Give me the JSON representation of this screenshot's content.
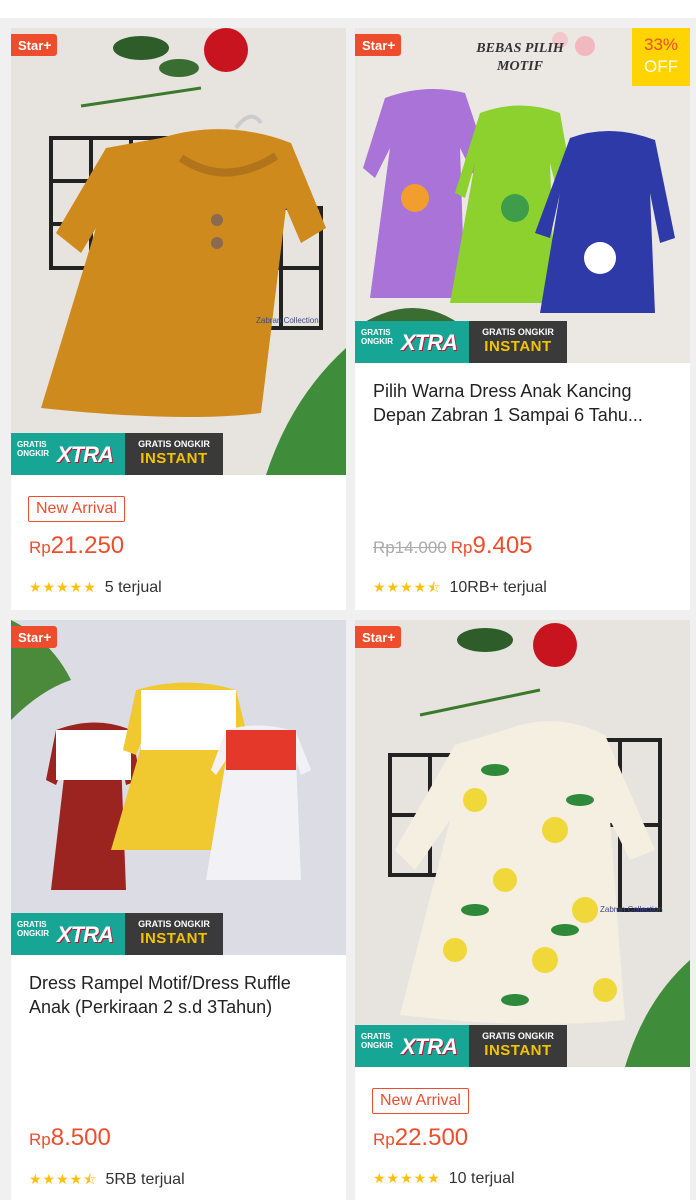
{
  "badges": {
    "star_plus": "Star",
    "plus_sign": "+"
  },
  "shipping": {
    "gratis_ongkir": "GRATIS ONGKIR",
    "xtra": "XTRA",
    "gratis_ongkir_instant_top": "GRATIS ONGKIR",
    "instant": "INSTANT"
  },
  "products": [
    {
      "title": "",
      "tag": "New Arrival",
      "price_currency": "Rp",
      "price_value": "21.250",
      "old_price": "",
      "rating_stars": "★★★★★",
      "sold": "5 terjual",
      "watermark": "Zabran Collection"
    },
    {
      "title": "Pilih Warna Dress Anak Kancing Depan Zabran 1 Sampai 6 Tahu...",
      "tag": "",
      "price_currency": "Rp",
      "price_value": "9.405",
      "old_price": "Rp14.000",
      "discount_pct": "33%",
      "discount_off": "OFF",
      "image_caption": "BEBAS PILIH MOTIF",
      "rating_stars": "★★★★⯪",
      "sold": "10RB+ terjual"
    },
    {
      "title": "Dress Rampel Motif/Dress Ruffle Anak (Perkiraan 2 s.d 3Tahun)",
      "tag": "",
      "price_currency": "Rp",
      "price_value": "8.500",
      "old_price": "",
      "rating_stars": "★★★★⯪",
      "sold": "5RB terjual"
    },
    {
      "title": "",
      "tag": "New Arrival",
      "price_currency": "Rp",
      "price_value": "22.500",
      "old_price": "",
      "rating_stars": "★★★★★",
      "sold": "10 terjual",
      "watermark": "Zabran Collection"
    }
  ],
  "colors": {
    "accent": "#ee4d2d",
    "star": "#ffc107",
    "xtra_teal": "#17a595",
    "instant_dark": "#3a3a3a"
  }
}
